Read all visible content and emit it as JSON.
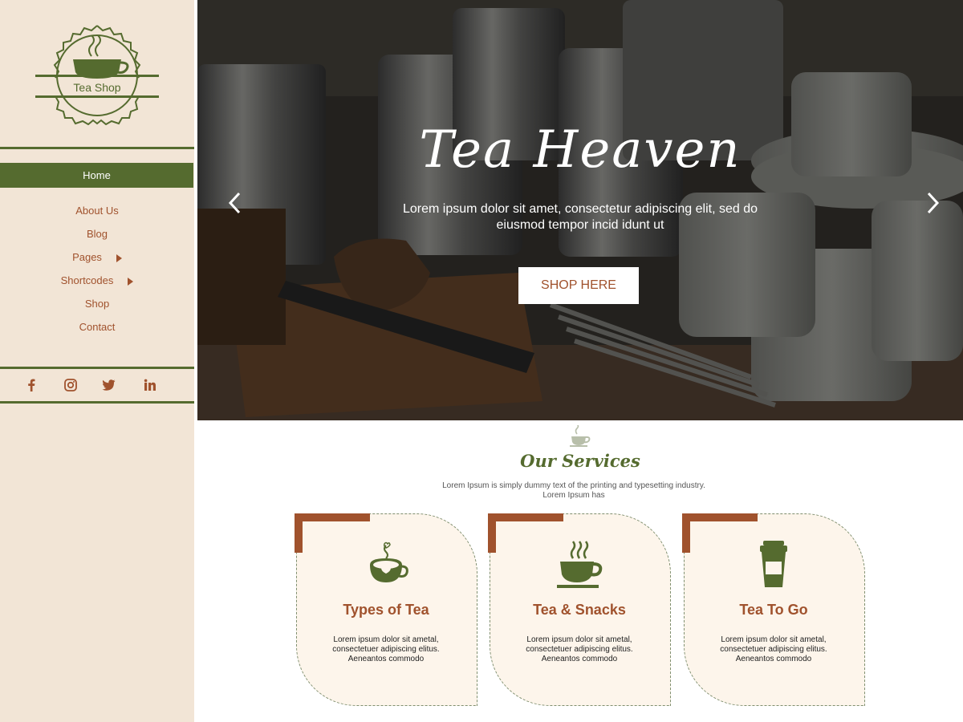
{
  "brand": {
    "logo_text": "Tea Shop"
  },
  "nav": {
    "home": "Home",
    "items": [
      "About Us",
      "Blog",
      "Pages",
      "Shortcodes",
      "Shop",
      "Contact"
    ]
  },
  "social": [
    "facebook-icon",
    "instagram-icon",
    "twitter-icon",
    "linkedin-icon"
  ],
  "hero": {
    "title": "Tea Heaven",
    "subtitle": "Lorem ipsum dolor sit amet, consectetur adipiscing elit, sed do eiusmod tempor incid idunt ut",
    "button": "SHOP HERE"
  },
  "services": {
    "title": "Our Services",
    "description": "Lorem Ipsum is simply dummy text of the printing and typesetting industry. Lorem Ipsum has",
    "cards": [
      {
        "title": "Types of Tea",
        "text": "Lorem ipsum dolor sit ametal, consectetuer adipiscing elitus. Aeneantos commodo",
        "icon": "tea-cup-heart-icon"
      },
      {
        "title": "Tea & Snacks",
        "text": "Lorem ipsum dolor sit ametal, consectetuer adipiscing elitus. Aeneantos commodo",
        "icon": "steaming-cup-icon"
      },
      {
        "title": "Tea To Go",
        "text": "Lorem ipsum dolor sit ametal, consectetuer adipiscing elitus. Aeneantos commodo",
        "icon": "takeaway-cup-icon"
      }
    ]
  },
  "colors": {
    "green": "#556b2f",
    "brown": "#a0522d",
    "sidebar_bg": "#f2e5d6",
    "card_bg": "#fdf5eb"
  }
}
